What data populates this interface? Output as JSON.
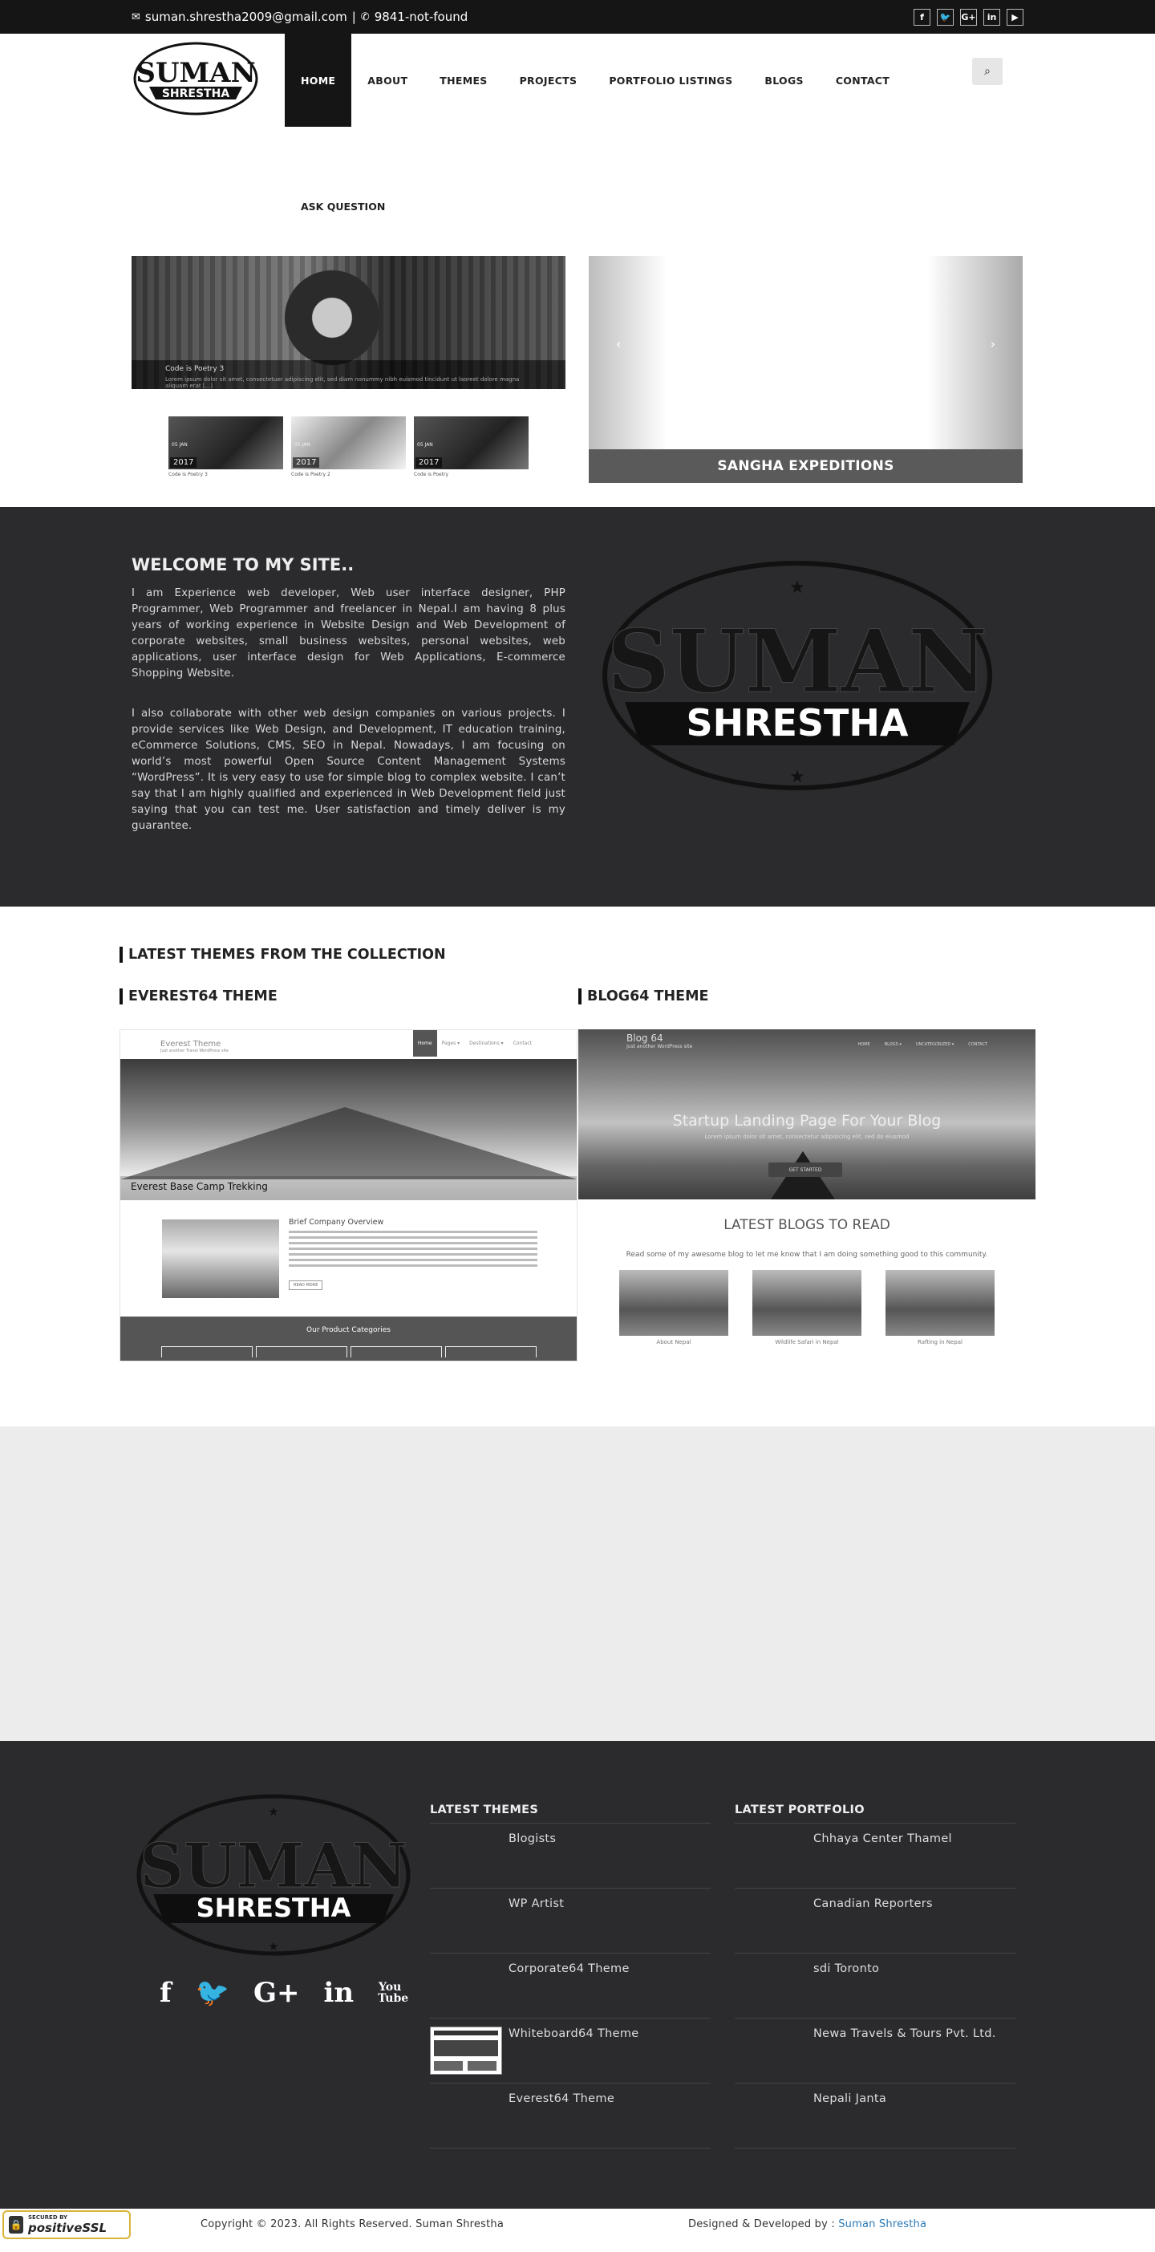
{
  "topbar": {
    "email": "suman.shrestha2009@gmail.com",
    "separator": "|",
    "phone": "9841-not-found",
    "social": [
      "f",
      "t",
      "G+",
      "in",
      "yt"
    ]
  },
  "logo": {
    "line1": "SUMAN",
    "line2": "SHRESTHA"
  },
  "menu": {
    "items": [
      "HOME",
      "ABOUT",
      "THEMES",
      "PROJECTS",
      "PORTFOLIO LISTINGS",
      "BLOGS",
      "CONTACT"
    ],
    "second_row": "ASK QUESTION"
  },
  "hero": {
    "main_caption": "Code is Poetry 3",
    "main_desc": "Lorem ipsum dolor sit amet, consectetuer adipiscing elit, sed diam nonummy nibh euismod tincidunt ut laoreet dolore magna aliquam erat [...]",
    "thumbs": [
      {
        "year": "2017",
        "date": "05 JAN",
        "label": "Code is Poetry 3"
      },
      {
        "year": "2017",
        "date": "05 JAN",
        "label": "Code is Poetry 2"
      },
      {
        "year": "2017",
        "date": "05 JAN",
        "label": "Code is Poetry"
      }
    ],
    "right_caption": "SANGHA EXPEDITIONS",
    "prev_icon": "‹",
    "next_icon": "›"
  },
  "welcome": {
    "title": "WELCOME TO MY SITE..",
    "p1": "I am Experience web developer, Web user interface designer, PHP Programmer, Web Programmer and freelancer in Nepal.I am having 8 plus years of working experience in Website Design and Web Development of corporate websites, small business websites, personal websites, web applications, user interface design for Web Applications, E-commerce Shopping Website.",
    "p2": "I also collaborate with other web design companies on various projects. I provide services like Web Design, and Development, IT education training, eCommerce Solutions, CMS, SEO in Nepal. Nowadays, I am focusing on world’s most powerful Open Source Content Management Systems “WordPress”. It is very easy to use for simple blog to complex website. I can’t say that I am highly qualified and experienced in Web Development field just saying that you can test me. User satisfaction and timely deliver is my guarantee."
  },
  "themes": {
    "section_title": "LATEST THEMES FROM THE COLLECTION",
    "theme1": {
      "title": "EVEREST64 THEME",
      "site_name": "Everest Theme",
      "tagline": "Just another Travel WordPress site",
      "nav": [
        "Home",
        "Pages ▾",
        "Destinations ▾",
        "Contact"
      ],
      "banner": "Everest Base Camp Trekking",
      "brief_title": "Brief Company Overview",
      "read_more": "READ MORE",
      "categories": "Our Product Categories"
    },
    "theme2": {
      "title": "BLOG64 THEME",
      "site_name": "Blog 64",
      "tagline": "Just another WordPress site",
      "nav": [
        "HOME",
        "BLOGS ▾",
        "UNCATEGORIZED ▾",
        "CONTACT"
      ],
      "headline": "Startup Landing Page For Your Blog",
      "sub": "Lorem ipsum dolor sit amet, consectetur adipisicing elit, sed do eiusmod",
      "button": "GET STARTED",
      "latest": "LATEST BLOGS TO READ",
      "latest_sub": "Read some of my awesome blog to let me know that I am doing something good to this community.",
      "posts": [
        "About Nepal",
        "Wildlife Safari in Nepal",
        "Rafting in Nepal"
      ]
    }
  },
  "footer": {
    "social": [
      "f",
      "t",
      "G+",
      "in",
      "You Tube"
    ],
    "latest_themes_title": "LATEST THEMES",
    "latest_themes": [
      "Blogists",
      "WP Artist",
      "Corporate64 Theme",
      "Whiteboard64 Theme",
      "Everest64 Theme"
    ],
    "latest_portfolio_title": "LATEST PORTFOLIO",
    "latest_portfolio": [
      "Chhaya Center Thamel",
      "Canadian Reporters",
      "sdi Toronto",
      "Newa Travels & Tours Pvt. Ltd.",
      "Nepali Janta"
    ]
  },
  "copyright": {
    "left": "Copyright © 2023. All Rights Reserved. Suman Shrestha",
    "right_prefix": "Designed & Developed by : ",
    "right_link": "Suman Shrestha"
  },
  "ssl": {
    "line1": "SECURED BY",
    "line2": "positiveSSL"
  }
}
